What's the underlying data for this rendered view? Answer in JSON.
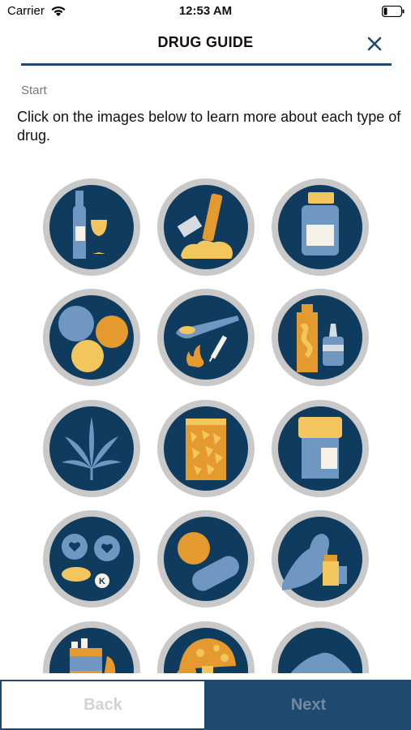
{
  "status_bar": {
    "carrier": "Carrier",
    "time": "12:53 AM",
    "wifi_icon": "wifi-icon",
    "battery_icon": "battery-icon"
  },
  "header": {
    "title": "DRUG GUIDE",
    "close_icon": "close-icon"
  },
  "breadcrumb": "Start",
  "intro_text": "Click on the images below to learn more about each type of drug.",
  "colors": {
    "navy": "#1d4a6e",
    "icon_circle": "#0f3b5f",
    "ring": "#c9c9c9",
    "light_blue": "#6f97c2",
    "orange": "#e49a2e",
    "yellow": "#f2c65c"
  },
  "drug_tiles": [
    {
      "icon": "alcohol-icon"
    },
    {
      "icon": "cocaine-icon"
    },
    {
      "icon": "pill-bottle-icon"
    },
    {
      "icon": "ecstasy-icon"
    },
    {
      "icon": "heroin-icon"
    },
    {
      "icon": "inhalants-icon"
    },
    {
      "icon": "cannabis-icon"
    },
    {
      "icon": "meth-bag-icon"
    },
    {
      "icon": "prescription-jar-icon"
    },
    {
      "icon": "ketamine-pills-icon"
    },
    {
      "icon": "pills-capsule-icon"
    },
    {
      "icon": "steroids-icon"
    },
    {
      "icon": "tobacco-icon"
    },
    {
      "icon": "mushrooms-icon"
    },
    {
      "icon": "powder-pile-icon"
    }
  ],
  "footer": {
    "back_label": "Back",
    "next_label": "Next"
  }
}
